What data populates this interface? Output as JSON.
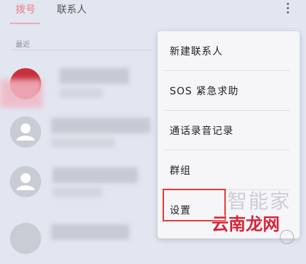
{
  "tabs": [
    {
      "label": "拨号",
      "active": true
    },
    {
      "label": "联系人",
      "active": false
    }
  ],
  "recent_label": "最近",
  "menu": {
    "items": [
      {
        "label": "新建联系人"
      },
      {
        "label": "SOS 紧急求助"
      },
      {
        "label": "通话录音记录"
      },
      {
        "label": "群组"
      },
      {
        "label": "设置"
      }
    ],
    "highlighted_item": "设置"
  },
  "watermarks": {
    "faint": "智能家",
    "brand": "云南龙网"
  },
  "colors": {
    "active_tab": "#f07a8a",
    "highlight_border": "#e53934",
    "brand_watermark": "#d6233a"
  }
}
